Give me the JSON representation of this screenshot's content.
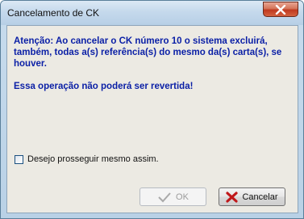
{
  "window": {
    "title": "Cancelamento de CK"
  },
  "message": {
    "warning": "Atenção: Ao cancelar o CK número 10 o sistema excluirá, também, todas a(s) referência(s) do mesmo da(s) carta(s), se houver.",
    "irreversible": "Essa operação não poderá ser revertida!"
  },
  "checkbox": {
    "label": "Desejo prosseguir mesmo assim.",
    "checked": false
  },
  "buttons": {
    "ok_label": "OK",
    "ok_enabled": false,
    "cancel_label": "Cancelar"
  },
  "icons": {
    "close": "close-icon",
    "ok": "checkmark-icon",
    "cancel": "red-x-icon"
  },
  "colors": {
    "message_text": "#0a1fa6",
    "cancel_icon": "#c0181a"
  }
}
